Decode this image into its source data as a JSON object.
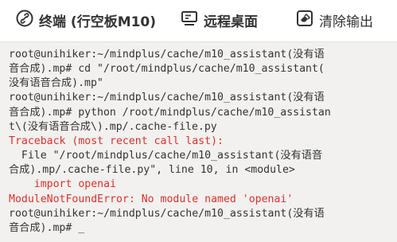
{
  "toolbar": {
    "terminal_label": "终端 (行空板M10)",
    "remote_label": "远程桌面",
    "clear_label": "清除输出"
  },
  "terminal": {
    "lines": [
      {
        "text": "root@unihiker:~/mindplus/cache/m10_assistant(没有语",
        "type": "normal"
      },
      {
        "text": "音合成).mp# cd \"/root/mindplus/cache/m10_assistant(",
        "type": "normal"
      },
      {
        "text": "没有语音合成).mp\"",
        "type": "normal"
      },
      {
        "text": "root@unihiker:~/mindplus/cache/m10_assistant(没有语",
        "type": "normal"
      },
      {
        "text": "音合成).mp# python /root/mindplus/cache/m10_assistan",
        "type": "normal"
      },
      {
        "text": "t\\(没有语音合成\\).mp/.cache-file.py",
        "type": "normal"
      },
      {
        "text": "Traceback (most recent call last):",
        "type": "error"
      },
      {
        "text": "  File \"/root/mindplus/cache/m10_assistant(没有语音",
        "type": "normal"
      },
      {
        "text": "合成).mp/.cache-file.py\", line 10, in <module>",
        "type": "normal"
      },
      {
        "text": "    import openai",
        "type": "error"
      },
      {
        "text": "ModuleNotFoundError: No module named 'openai'",
        "type": "error"
      },
      {
        "text": "root@unihiker:~/mindplus/cache/m10_assistant(没有语",
        "type": "normal"
      },
      {
        "text": "音合成).mp# _",
        "type": "normal"
      }
    ]
  },
  "colors": {
    "terminal_bg": "#f2f1ef",
    "text": "#333333",
    "error": "#d8322c"
  },
  "icons": {
    "terminal": "link-icon",
    "remote": "monitor-icon",
    "clear": "eraser-icon"
  }
}
